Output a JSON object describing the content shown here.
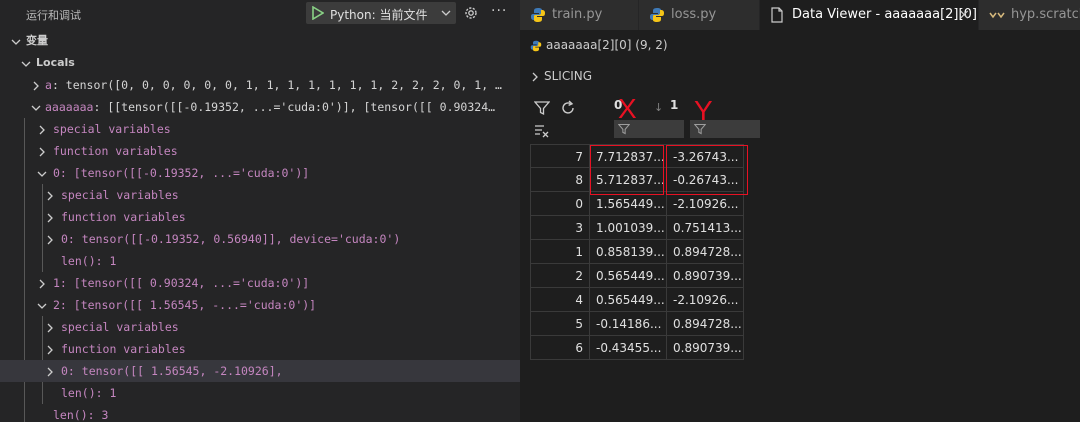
{
  "debug": {
    "run_title": "运行和调试",
    "config_label": "Python: 当前文件",
    "more": "···"
  },
  "variables": {
    "section": "变量",
    "scope": "Locals",
    "rows": [
      {
        "name": "a",
        "value": ": tensor([0, 0, 0, 0, 0, 0, 1, 1, 1, 1, 1, 1, 1, 2, 2, 2, 0, 1, …"
      },
      {
        "name": "aaaaaaa",
        "value": ": [[tensor([[-0.19352,  ...='cuda:0')], [tensor([[ 0.90324…"
      },
      {
        "text": "special variables"
      },
      {
        "text": "function variables"
      },
      {
        "text": "0: [tensor([[-0.19352,  ...='cuda:0')]"
      },
      {
        "text": "special variables"
      },
      {
        "text": "function variables"
      },
      {
        "text": "0: tensor([[-0.19352,  0.56940]], device='cuda:0')"
      },
      {
        "text": "len(): 1"
      },
      {
        "text": "1: [tensor([[ 0.90324,  ...='cuda:0')]"
      },
      {
        "text": "2: [tensor([[ 1.56545, -...='cuda:0')]"
      },
      {
        "text": "special variables"
      },
      {
        "text": "function variables"
      },
      {
        "text": "0: tensor([[ 1.56545, -2.10926],"
      },
      {
        "text": "len(): 1"
      },
      {
        "text": "len(): 3"
      }
    ]
  },
  "tabs": [
    {
      "label": "train.py",
      "icon": "python-icon"
    },
    {
      "label": "loss.py",
      "icon": "python-icon"
    },
    {
      "label": "Data Viewer - aaaaaaa[2][0]",
      "icon": "file-icon",
      "close": "×"
    },
    {
      "label": "hyp.scratch.p",
      "icon": "yaml-icon"
    }
  ],
  "viewer": {
    "breadcrumb": "aaaaaaa[2][0] (9, 2)",
    "slicing": "SLICING",
    "columns": [
      "0",
      "1"
    ],
    "sort_arrow": "↓",
    "rows": [
      {
        "index": "7",
        "c0": "7.712837...",
        "c1": "-3.26743..."
      },
      {
        "index": "8",
        "c0": "5.712837...",
        "c1": "-0.26743..."
      },
      {
        "index": "0",
        "c0": "1.565449...",
        "c1": "-2.10926..."
      },
      {
        "index": "3",
        "c0": "1.001039...",
        "c1": "0.751413..."
      },
      {
        "index": "1",
        "c0": "0.858139...",
        "c1": "0.894728..."
      },
      {
        "index": "2",
        "c0": "0.565449...",
        "c1": "0.890739..."
      },
      {
        "index": "4",
        "c0": "0.565449...",
        "c1": "-2.10926..."
      },
      {
        "index": "5",
        "c0": "-0.14186...",
        "c1": "0.894728..."
      },
      {
        "index": "6",
        "c0": "-0.43455...",
        "c1": "0.890739..."
      }
    ]
  },
  "annotations": {
    "x_label": "X",
    "y_label": "Y",
    "color": "#e81123"
  }
}
